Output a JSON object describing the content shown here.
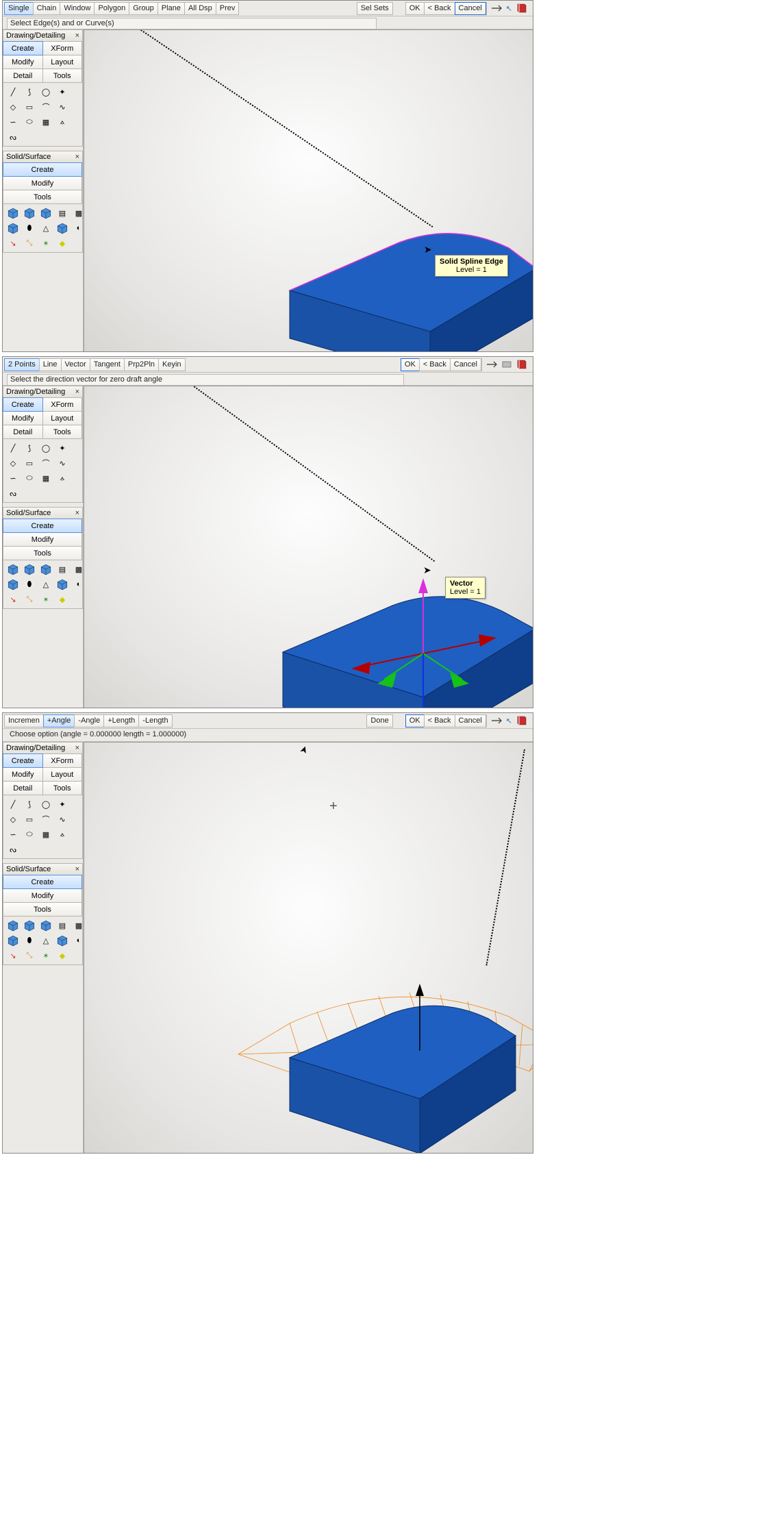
{
  "panels": {
    "drawing_title": "Drawing/Detailing",
    "solid_title": "Solid/Surface",
    "create": "Create",
    "xform": "XForm",
    "modify": "Modify",
    "layout": "Layout",
    "detail": "Detail",
    "tools": "Tools"
  },
  "common": {
    "ok": "OK",
    "back": "< Back",
    "cancel": "Cancel",
    "sel_sets": "Sel Sets"
  },
  "frame1": {
    "toolbar": {
      "b1": "Single",
      "b2": "Chain",
      "b3": "Window",
      "b4": "Polygon",
      "b5": "Group",
      "b6": "Plane",
      "b7": "All Dsp",
      "b8": "Prev"
    },
    "prompt": "Select Edge(s) and or Curve(s)",
    "tooltip_title": "Solid Spline Edge",
    "tooltip_sub": "Level = 1"
  },
  "frame2": {
    "toolbar": {
      "b1": "2 Points",
      "b2": "Line",
      "b3": "Vector",
      "b4": "Tangent",
      "b5": "Prp2Pln",
      "b6": "Keyin"
    },
    "prompt": "Select the direction vector for zero draft angle",
    "tooltip_title": "Vector",
    "tooltip_sub": "Level = 1"
  },
  "frame3": {
    "toolbar": {
      "b1": "Incremen",
      "b2": "+Angle",
      "b3": "-Angle",
      "b4": "+Length",
      "b5": "-Length"
    },
    "done": "Done",
    "prompt": "Choose option (angle = 0.000000 length = 1.000000)"
  }
}
